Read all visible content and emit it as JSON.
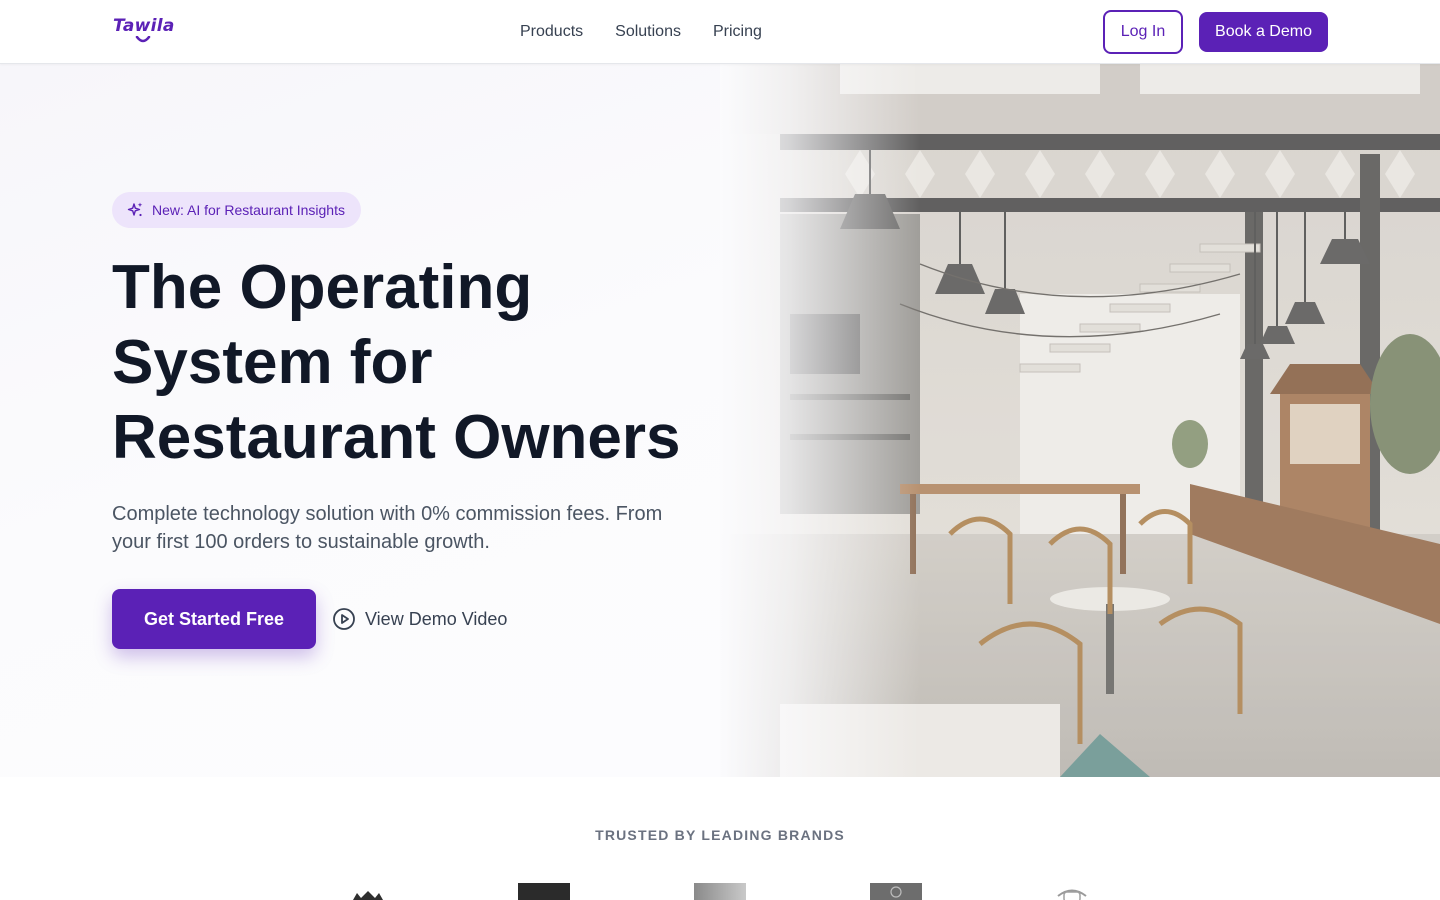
{
  "header": {
    "logo_text": "Tawila",
    "nav": [
      {
        "label": "Products"
      },
      {
        "label": "Solutions"
      },
      {
        "label": "Pricing"
      }
    ],
    "login_label": "Log In",
    "demo_label": "Book a Demo"
  },
  "hero": {
    "badge_label": "New: AI for Restaurant Insights",
    "title": "The Operating System for Restaurant Owners",
    "subtitle": "Complete technology solution with 0% commission fees. From your first 100 orders to sustainable growth.",
    "cta_primary": "Get Started Free",
    "cta_secondary": "View Demo Video"
  },
  "trusted": {
    "title": "TRUSTED BY LEADING BRANDS",
    "brands": [
      "crown-logo",
      "dark-square-logo",
      "gradient-logo",
      "badge-logo",
      "emblem-logo"
    ]
  },
  "colors": {
    "brand": "#5b21b6",
    "badge_bg": "#ede4fb",
    "text_dark": "#111827",
    "text_muted": "#4b5563"
  }
}
